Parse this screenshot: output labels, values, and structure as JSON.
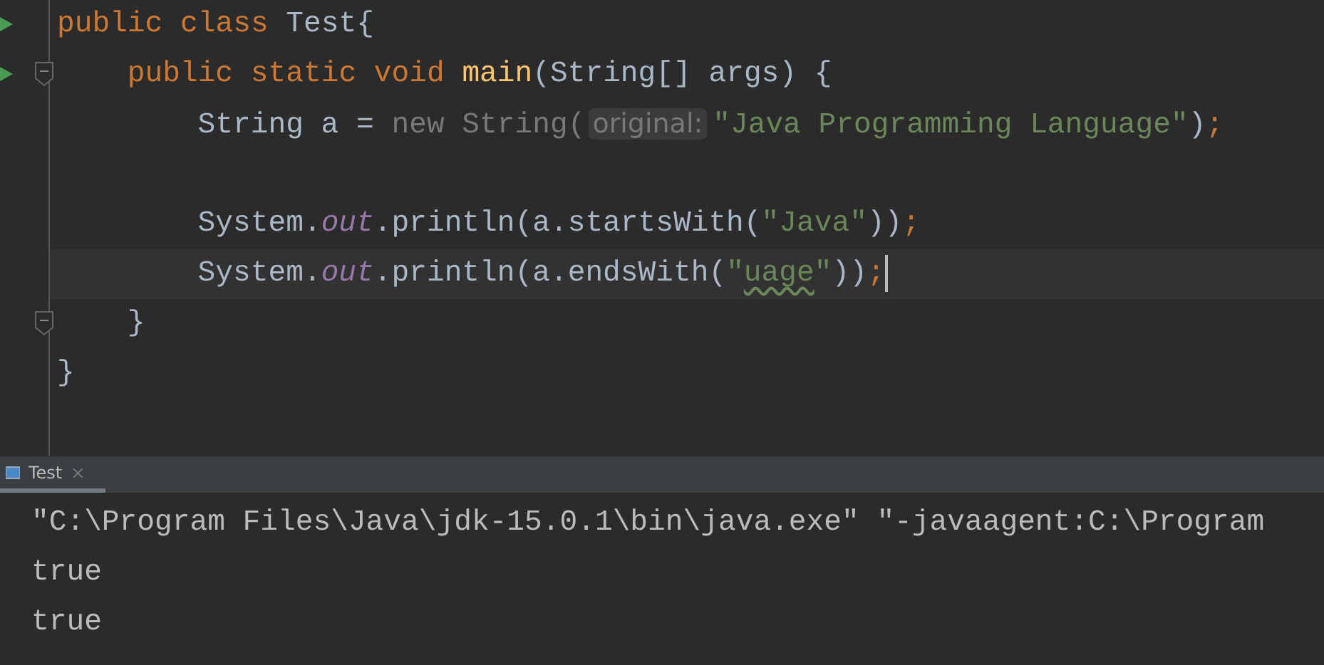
{
  "editor": {
    "lines": [
      {
        "run": true,
        "fold": false,
        "current": false,
        "tokens": [
          {
            "kind": "keyword",
            "text": "public class "
          },
          {
            "kind": "plain",
            "text": "Test{"
          }
        ],
        "children": [
          {
            "run": true,
            "fold": true,
            "current": false,
            "tokens": [
              {
                "kind": "keyword",
                "text": "public static void "
              },
              {
                "kind": "method",
                "text": "main"
              },
              {
                "kind": "plain",
                "text": "(String[] args) {"
              }
            ],
            "children": [
              {
                "run": false,
                "fold": false,
                "current": false,
                "tokens": [
                  {
                    "kind": "plain",
                    "text": "String a = "
                  },
                  {
                    "kind": "muted",
                    "text": "new String("
                  },
                  {
                    "kind": "hint",
                    "text": "original:"
                  },
                  {
                    "kind": "string",
                    "text": "\"Java Programming Language\""
                  },
                  {
                    "kind": "plain",
                    "text": ")"
                  },
                  {
                    "kind": "keyword",
                    "text": ";"
                  }
                ]
              },
              {
                "run": false,
                "fold": false,
                "current": false
              },
              {
                "run": false,
                "fold": false,
                "current": false,
                "tokens": [
                  {
                    "kind": "plain",
                    "text": "System."
                  },
                  {
                    "kind": "field",
                    "text": "out"
                  },
                  {
                    "kind": "plain",
                    "text": ".println(a.startsWith("
                  },
                  {
                    "kind": "string",
                    "text": "\"Java\""
                  },
                  {
                    "kind": "plain",
                    "text": "))"
                  },
                  {
                    "kind": "keyword",
                    "text": ";"
                  }
                ]
              },
              {
                "run": false,
                "fold": false,
                "current": true,
                "tokens": [
                  {
                    "kind": "plain",
                    "text": "System."
                  },
                  {
                    "kind": "field",
                    "text": "out"
                  },
                  {
                    "kind": "plain",
                    "text": ".println(a.endsWith("
                  },
                  {
                    "kind": "string",
                    "text": "\""
                  },
                  {
                    "kind": "typo",
                    "text": "uage"
                  },
                  {
                    "kind": "string",
                    "text": "\""
                  },
                  {
                    "kind": "plain",
                    "text": "))"
                  },
                  {
                    "kind": "keyword",
                    "text": ";"
                  }
                ]
              }
            ]
          },
          {
            "run": false,
            "fold": true,
            "current": false,
            "tokens": [
              {
                "kind": "plain",
                "text": "}"
              }
            ]
          }
        ]
      },
      {
        "run": false,
        "fold": false,
        "current": false,
        "tokens": [
          {
            "kind": "plain",
            "text": "}"
          }
        ]
      }
    ]
  },
  "console": {
    "tab": {
      "label": "Test",
      "close": "×",
      "selected": true
    },
    "lines": [
      "\"C:\\Program Files\\Java\\jdk-15.0.1\\bin\\java.exe\" \"-javaagent:C:\\Program",
      "true",
      "true"
    ]
  }
}
